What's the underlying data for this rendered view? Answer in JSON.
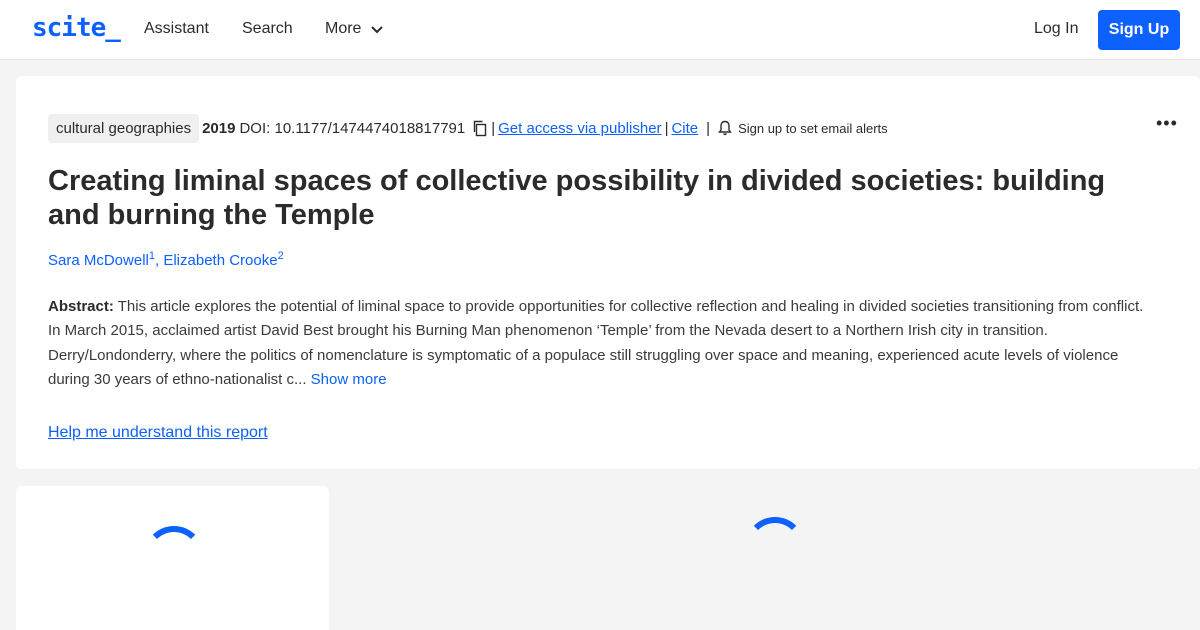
{
  "nav": {
    "logo": "scite_",
    "assistant": "Assistant",
    "search": "Search",
    "more": "More",
    "login": "Log In",
    "signup": "Sign Up"
  },
  "paper": {
    "journal": "cultural geographies",
    "year": "2019",
    "doi": "DOI: 10.1177/1474474018817791",
    "sep": "|",
    "get_access": "Get access via publisher",
    "cite": "Cite",
    "alerts": "Sign up to set email alerts",
    "title": "Creating liminal spaces of collective possibility in divided societies: building and burning the Temple",
    "authors": [
      {
        "name": "Sara McDowell",
        "sup": "1"
      },
      {
        "name": "Elizabeth Crooke",
        "sup": "2"
      }
    ],
    "author_sep": ",",
    "abstract_label": "Abstract:",
    "abstract_text": " This article explores the potential of liminal space to provide opportunities for collective reflection and healing in divided societies transitioning from conflict. In March 2015, acclaimed artist David Best brought his Burning Man phenomenon ‘Temple’ from the Nevada desert to a Northern Irish city in transition. Derry/Londonderry, where the politics of nomenclature is symptomatic of a populace still struggling over space and meaning, experienced acute levels of violence during 30 years of ethno-nationalist c...",
    "show_more": "Show more",
    "help_link": "Help me understand this report"
  },
  "colors": {
    "brand": "#0d61ff",
    "background": "#f4f4f4"
  }
}
